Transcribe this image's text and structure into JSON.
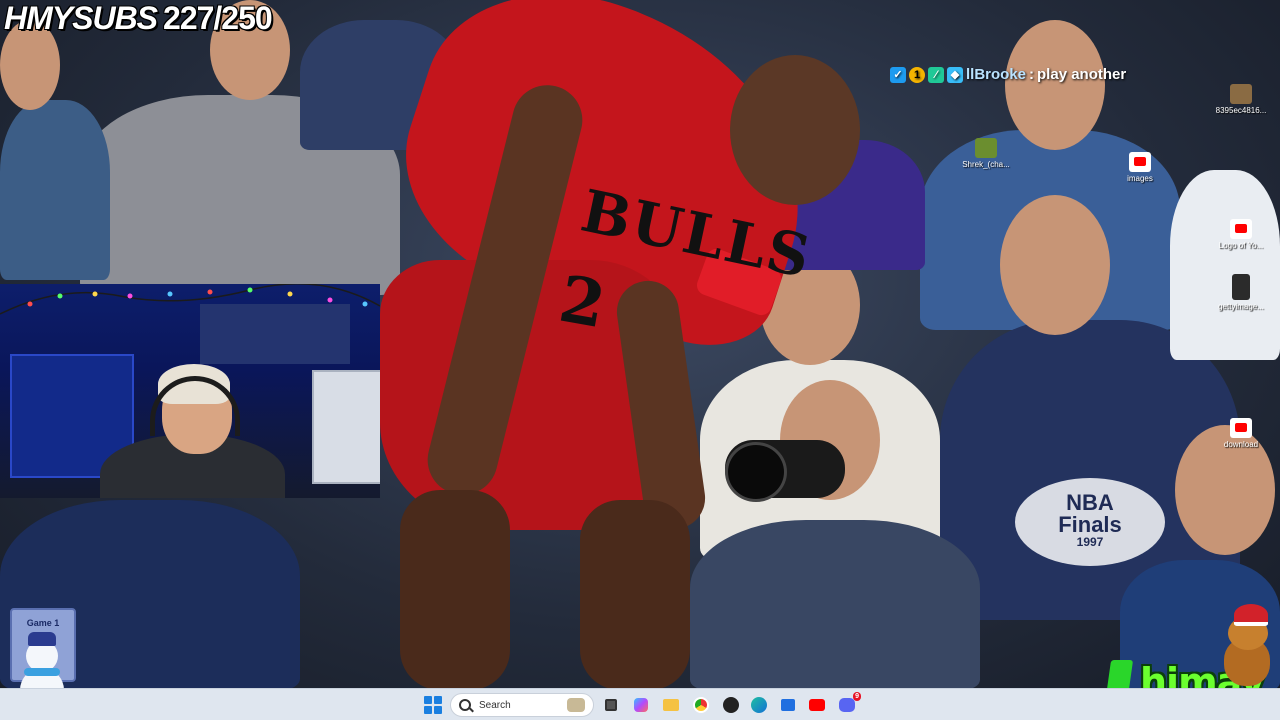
{
  "overlay": {
    "sub_label": "HMYSUBS",
    "sub_count": "227/250",
    "logo_text": "himay"
  },
  "chat": {
    "username": "llBrooke",
    "separator": ":",
    "message": "play another"
  },
  "photo": {
    "jersey_text": "BULLS",
    "jersey_number": "2",
    "badge_text_1": "NBA",
    "badge_text_2": "Finals",
    "badge_text_3": "1997"
  },
  "webcam": {
    "card_text": "Game 1"
  },
  "desktop_icons": [
    {
      "label": "8395ec4816...",
      "icon": "image-file-icon"
    },
    {
      "label": "Shrek_(cha...",
      "icon": "shrek-icon"
    },
    {
      "label": "images",
      "icon": "youtube-icon"
    },
    {
      "label": "Logo of Yo...",
      "icon": "youtube-icon"
    },
    {
      "label": "gettyimage...",
      "icon": "image-file-icon"
    },
    {
      "label": "download",
      "icon": "youtube-icon"
    }
  ],
  "taskbar": {
    "search_placeholder": "Search",
    "discord_badge": "9",
    "apps": [
      "start",
      "search",
      "task-view",
      "copilot",
      "file-explorer",
      "chrome",
      "obs",
      "edge",
      "microsoft-store",
      "youtube",
      "discord"
    ]
  },
  "colors": {
    "taskbar_bg": "#dfe6ef",
    "logo_green": "#6bff2f",
    "jersey_red": "#c4151c",
    "webcam_blue": "#0d1e6b"
  }
}
